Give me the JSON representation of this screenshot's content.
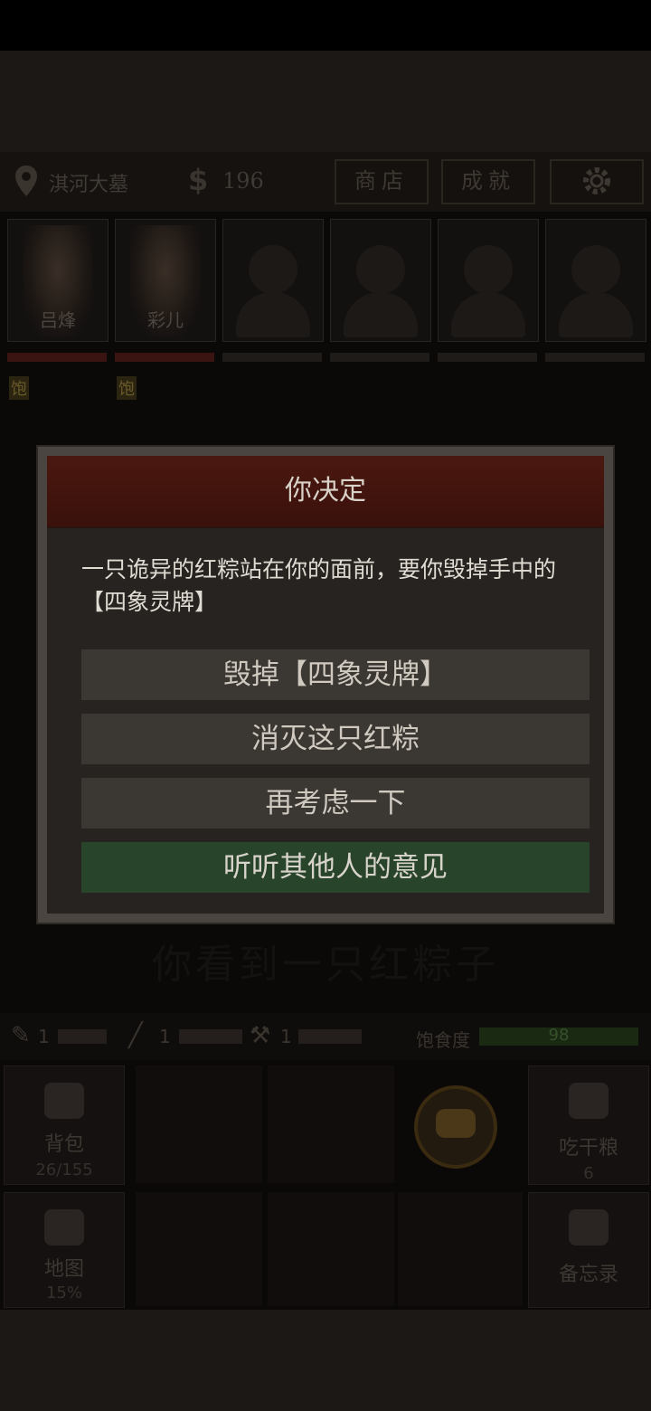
{
  "topbar": {
    "location": "淇河大墓",
    "money_symbol": "$",
    "money": "196",
    "shop_label": "商店",
    "achievement_label": "成就"
  },
  "characters": [
    {
      "name": "吕烽",
      "status": "饱"
    },
    {
      "name": "彩儿",
      "status": "饱"
    }
  ],
  "dialog": {
    "title": "你决定",
    "text": "一只诡异的红粽站在你的面前，要你毁掉手中的【四象灵牌】",
    "options": [
      "毁掉【四象灵牌】",
      "消灭这只红粽",
      "再考虑一下",
      "听听其他人的意见"
    ]
  },
  "background_prompt": "你看到一只红粽子",
  "resources": {
    "item1_count": "1",
    "item2_count": "1",
    "item3_count": "1",
    "satiety_label": "饱食度",
    "satiety_value": "98"
  },
  "bottom": {
    "backpack_label": "背包",
    "backpack_count": "26/155",
    "map_label": "地图",
    "map_percent": "15%",
    "eat_label": "吃干粮",
    "eat_count": "6",
    "memo_label": "备忘录"
  },
  "colors": {
    "dialog_header": "#4a1810",
    "option_default": "#3b3733",
    "option_highlight": "#28442a"
  }
}
